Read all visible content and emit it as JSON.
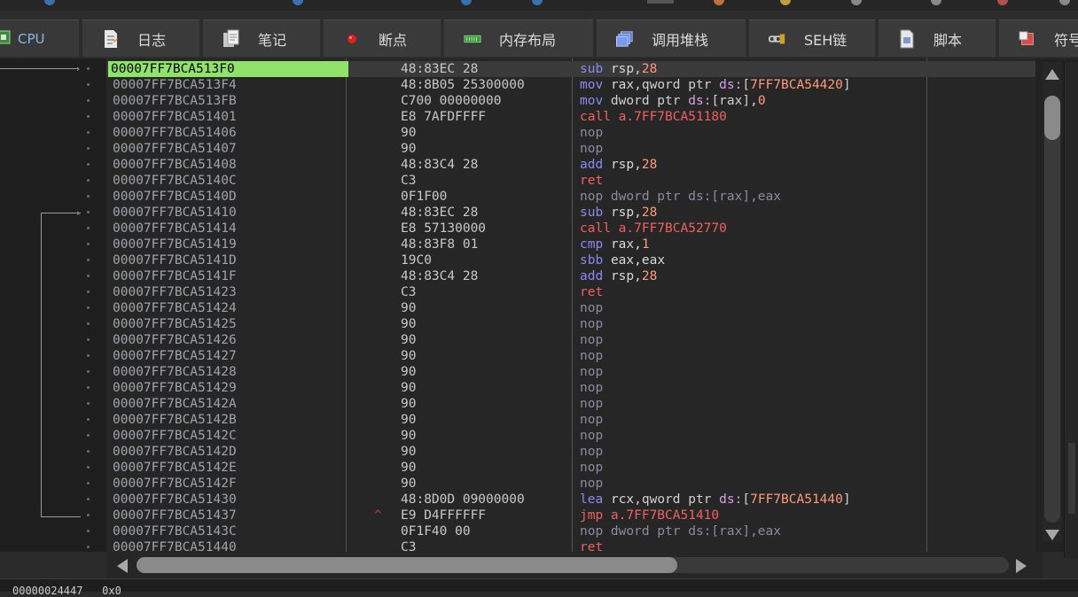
{
  "tabs": [
    {
      "label": "CPU",
      "icon": "cpu-icon",
      "active": true
    },
    {
      "label": "日志",
      "icon": "log-icon"
    },
    {
      "label": "笔记",
      "icon": "notes-icon"
    },
    {
      "label": "断点",
      "icon": "breakpoint-icon"
    },
    {
      "label": "内存布局",
      "icon": "memory-map-icon"
    },
    {
      "label": "调用堆栈",
      "icon": "call-stack-icon"
    },
    {
      "label": "SEH链",
      "icon": "seh-chain-icon"
    },
    {
      "label": "脚本",
      "icon": "script-icon"
    },
    {
      "label": "符号",
      "icon": "symbols-icon"
    }
  ],
  "disassembly": {
    "rows": [
      {
        "address": "00007FF7BCA513F0",
        "bytes": "48:83EC 28",
        "instr": [
          [
            "sub",
            "t-mn"
          ],
          [
            " ",
            "t-plain"
          ],
          [
            "rsp",
            "t-reg"
          ],
          [
            ",",
            "t-plain"
          ],
          [
            "28",
            "t-num"
          ]
        ],
        "current": true
      },
      {
        "address": "00007FF7BCA513F4",
        "bytes": "48:8B05 25300000",
        "instr": [
          [
            "mov",
            "t-mn"
          ],
          [
            " ",
            "t-plain"
          ],
          [
            "rax",
            "t-reg"
          ],
          [
            ",qword ptr ",
            "t-plain"
          ],
          [
            "ds:",
            "t-seg"
          ],
          [
            "[",
            "t-plain"
          ],
          [
            "7FF7BCA54420",
            "t-addr"
          ],
          [
            "]",
            "t-plain"
          ]
        ]
      },
      {
        "address": "00007FF7BCA513FB",
        "bytes": "C700 00000000",
        "instr": [
          [
            "mov",
            "t-mn"
          ],
          [
            " dword ptr ",
            "t-plain"
          ],
          [
            "ds:",
            "t-seg"
          ],
          [
            "[rax],",
            "t-plain"
          ],
          [
            "0",
            "t-num"
          ]
        ]
      },
      {
        "address": "00007FF7BCA51401",
        "bytes": "E8 7AFDFFFF",
        "instr": [
          [
            "call a.7FF7BCA51180",
            "t-call"
          ]
        ]
      },
      {
        "address": "00007FF7BCA51406",
        "bytes": "90",
        "instr": [
          [
            "nop",
            "t-nop"
          ]
        ]
      },
      {
        "address": "00007FF7BCA51407",
        "bytes": "90",
        "instr": [
          [
            "nop",
            "t-nop"
          ]
        ]
      },
      {
        "address": "00007FF7BCA51408",
        "bytes": "48:83C4 28",
        "instr": [
          [
            "add",
            "t-mn"
          ],
          [
            " ",
            "t-plain"
          ],
          [
            "rsp",
            "t-reg"
          ],
          [
            ",",
            "t-plain"
          ],
          [
            "28",
            "t-num"
          ]
        ]
      },
      {
        "address": "00007FF7BCA5140C",
        "bytes": "C3",
        "instr": [
          [
            "ret",
            "t-ret"
          ]
        ]
      },
      {
        "address": "00007FF7BCA5140D",
        "bytes": "0F1F00",
        "instr": [
          [
            "nop dword ptr ",
            "t-nop"
          ],
          [
            "ds:",
            "t-nop"
          ],
          [
            "[rax],eax",
            "t-nop"
          ]
        ]
      },
      {
        "address": "00007FF7BCA51410",
        "bytes": "48:83EC 28",
        "instr": [
          [
            "sub",
            "t-mn"
          ],
          [
            " ",
            "t-plain"
          ],
          [
            "rsp",
            "t-reg"
          ],
          [
            ",",
            "t-plain"
          ],
          [
            "28",
            "t-num"
          ]
        ]
      },
      {
        "address": "00007FF7BCA51414",
        "bytes": "E8 57130000",
        "instr": [
          [
            "call a.7FF7BCA52770",
            "t-call"
          ]
        ]
      },
      {
        "address": "00007FF7BCA51419",
        "bytes": "48:83F8 01",
        "instr": [
          [
            "cmp",
            "t-mn"
          ],
          [
            " ",
            "t-plain"
          ],
          [
            "rax",
            "t-reg"
          ],
          [
            ",",
            "t-plain"
          ],
          [
            "1",
            "t-num"
          ]
        ]
      },
      {
        "address": "00007FF7BCA5141D",
        "bytes": "19C0",
        "instr": [
          [
            "sbb",
            "t-mn"
          ],
          [
            " ",
            "t-plain"
          ],
          [
            "eax,eax",
            "t-reg"
          ]
        ]
      },
      {
        "address": "00007FF7BCA5141F",
        "bytes": "48:83C4 28",
        "instr": [
          [
            "add",
            "t-mn"
          ],
          [
            " ",
            "t-plain"
          ],
          [
            "rsp",
            "t-reg"
          ],
          [
            ",",
            "t-plain"
          ],
          [
            "28",
            "t-num"
          ]
        ]
      },
      {
        "address": "00007FF7BCA51423",
        "bytes": "C3",
        "instr": [
          [
            "ret",
            "t-ret"
          ]
        ]
      },
      {
        "address": "00007FF7BCA51424",
        "bytes": "90",
        "instr": [
          [
            "nop",
            "t-nop"
          ]
        ]
      },
      {
        "address": "00007FF7BCA51425",
        "bytes": "90",
        "instr": [
          [
            "nop",
            "t-nop"
          ]
        ]
      },
      {
        "address": "00007FF7BCA51426",
        "bytes": "90",
        "instr": [
          [
            "nop",
            "t-nop"
          ]
        ]
      },
      {
        "address": "00007FF7BCA51427",
        "bytes": "90",
        "instr": [
          [
            "nop",
            "t-nop"
          ]
        ]
      },
      {
        "address": "00007FF7BCA51428",
        "bytes": "90",
        "instr": [
          [
            "nop",
            "t-nop"
          ]
        ]
      },
      {
        "address": "00007FF7BCA51429",
        "bytes": "90",
        "instr": [
          [
            "nop",
            "t-nop"
          ]
        ]
      },
      {
        "address": "00007FF7BCA5142A",
        "bytes": "90",
        "instr": [
          [
            "nop",
            "t-nop"
          ]
        ]
      },
      {
        "address": "00007FF7BCA5142B",
        "bytes": "90",
        "instr": [
          [
            "nop",
            "t-nop"
          ]
        ]
      },
      {
        "address": "00007FF7BCA5142C",
        "bytes": "90",
        "instr": [
          [
            "nop",
            "t-nop"
          ]
        ]
      },
      {
        "address": "00007FF7BCA5142D",
        "bytes": "90",
        "instr": [
          [
            "nop",
            "t-nop"
          ]
        ]
      },
      {
        "address": "00007FF7BCA5142E",
        "bytes": "90",
        "instr": [
          [
            "nop",
            "t-nop"
          ]
        ]
      },
      {
        "address": "00007FF7BCA5142F",
        "bytes": "90",
        "instr": [
          [
            "nop",
            "t-nop"
          ]
        ]
      },
      {
        "address": "00007FF7BCA51430",
        "bytes": "48:8D0D 09000000",
        "instr": [
          [
            "lea",
            "t-mn"
          ],
          [
            " ",
            "t-plain"
          ],
          [
            "rcx",
            "t-reg"
          ],
          [
            ",qword ptr ",
            "t-plain"
          ],
          [
            "ds:",
            "t-seg"
          ],
          [
            "[",
            "t-plain"
          ],
          [
            "7FF7BCA51440",
            "t-addr"
          ],
          [
            "]",
            "t-plain"
          ]
        ]
      },
      {
        "address": "00007FF7BCA51437",
        "bytes": "E9 D4FFFFFF",
        "instr": [
          [
            "jmp a.7FF7BCA51410",
            "t-jmp"
          ]
        ],
        "mark": "^"
      },
      {
        "address": "00007FF7BCA5143C",
        "bytes": "0F1F40 00",
        "instr": [
          [
            "nop dword ptr ",
            "t-nop"
          ],
          [
            "ds:",
            "t-nop"
          ],
          [
            "[rax],eax",
            "t-nop"
          ]
        ]
      },
      {
        "address": "00007FF7BCA51440",
        "bytes": "C3",
        "instr": [
          [
            "ret",
            "t-ret"
          ]
        ]
      }
    ]
  },
  "status_bar": {
    "text": "00000024447   0x0"
  }
}
